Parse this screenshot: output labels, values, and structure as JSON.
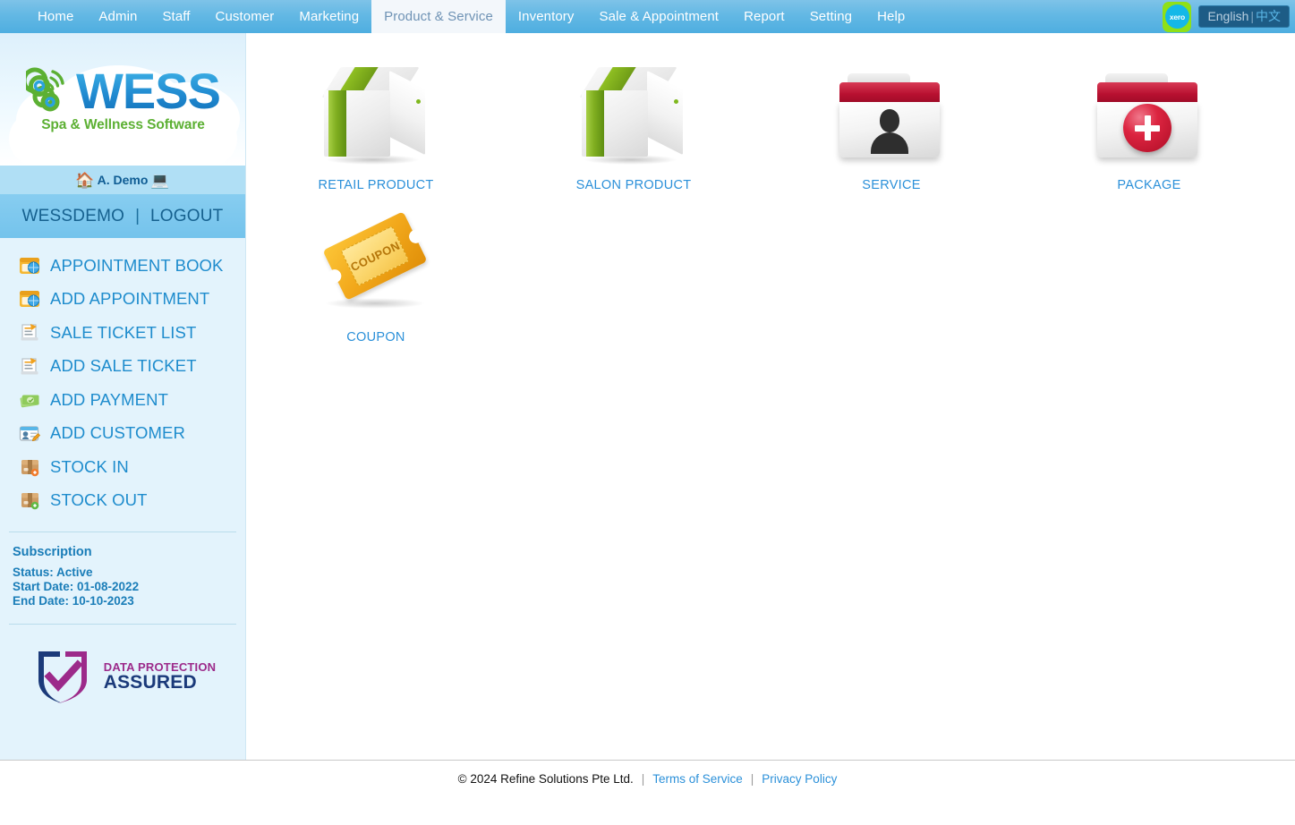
{
  "topnav": {
    "items": [
      {
        "label": "Home",
        "active": false
      },
      {
        "label": "Admin",
        "active": false
      },
      {
        "label": "Staff",
        "active": false
      },
      {
        "label": "Customer",
        "active": false
      },
      {
        "label": "Marketing",
        "active": false
      },
      {
        "label": "Product & Service",
        "active": true
      },
      {
        "label": "Inventory",
        "active": false
      },
      {
        "label": "Sale & Appointment",
        "active": false
      },
      {
        "label": "Report",
        "active": false
      },
      {
        "label": "Setting",
        "active": false
      },
      {
        "label": "Help",
        "active": false
      }
    ],
    "xero_label": "xero",
    "language": {
      "english": "English",
      "separator": "|",
      "chinese": "中文"
    },
    "colors": {
      "bar_top": "#7ec3e8",
      "bar_bottom": "#4eaee0",
      "active_bg": "#f3f7fb",
      "active_text": "#6f93b5"
    }
  },
  "sidebar": {
    "logo": {
      "title": "WESS",
      "tagline": "Spa & Wellness Software"
    },
    "demo_band": {
      "home_icon": "house-icon",
      "label": "A. Demo",
      "device_icon": "laptop-icon"
    },
    "user_band": {
      "account": "WESSDEMO",
      "separator": "|",
      "logout": "LOGOUT"
    },
    "menu": [
      {
        "label": "APPOINTMENT BOOK",
        "icon": "appointment-book-icon"
      },
      {
        "label": "ADD APPOINTMENT",
        "icon": "add-appointment-icon"
      },
      {
        "label": "SALE TICKET LIST",
        "icon": "sale-ticket-list-icon"
      },
      {
        "label": "ADD SALE TICKET",
        "icon": "add-sale-ticket-icon"
      },
      {
        "label": "ADD PAYMENT",
        "icon": "add-payment-icon"
      },
      {
        "label": "ADD CUSTOMER",
        "icon": "add-customer-icon"
      },
      {
        "label": "STOCK IN",
        "icon": "stock-in-icon"
      },
      {
        "label": "STOCK OUT",
        "icon": "stock-out-icon"
      }
    ],
    "subscription": {
      "title": "Subscription",
      "status": "Status: Active",
      "start_date": "Start Date: 01-08-2022",
      "end_date": "End Date: 10-10-2023"
    },
    "badge": {
      "line1": "DATA PROTECTION",
      "line2": "ASSURED"
    },
    "colors": {
      "background": "#e3f3fc",
      "demo_band": "#b0dff5",
      "user_band": "#7ec8ef",
      "link_text": "#1e8ccd"
    }
  },
  "main": {
    "tiles": [
      {
        "label": "RETAIL PRODUCT",
        "icon": "box-product-icon"
      },
      {
        "label": "SALON PRODUCT",
        "icon": "box-product-icon"
      },
      {
        "label": "SERVICE",
        "icon": "folder-person-icon"
      },
      {
        "label": "PACKAGE",
        "icon": "folder-plus-icon"
      },
      {
        "label": "COUPON",
        "icon": "coupon-ticket-icon"
      }
    ],
    "coupon_art_text": "COUPON",
    "label_color": "#2b90d9"
  },
  "footer": {
    "copyright": "© 2024 Refine Solutions Pte Ltd.",
    "separator_1": "|",
    "terms": "Terms of Service",
    "separator_2": "|",
    "privacy": "Privacy Policy"
  }
}
